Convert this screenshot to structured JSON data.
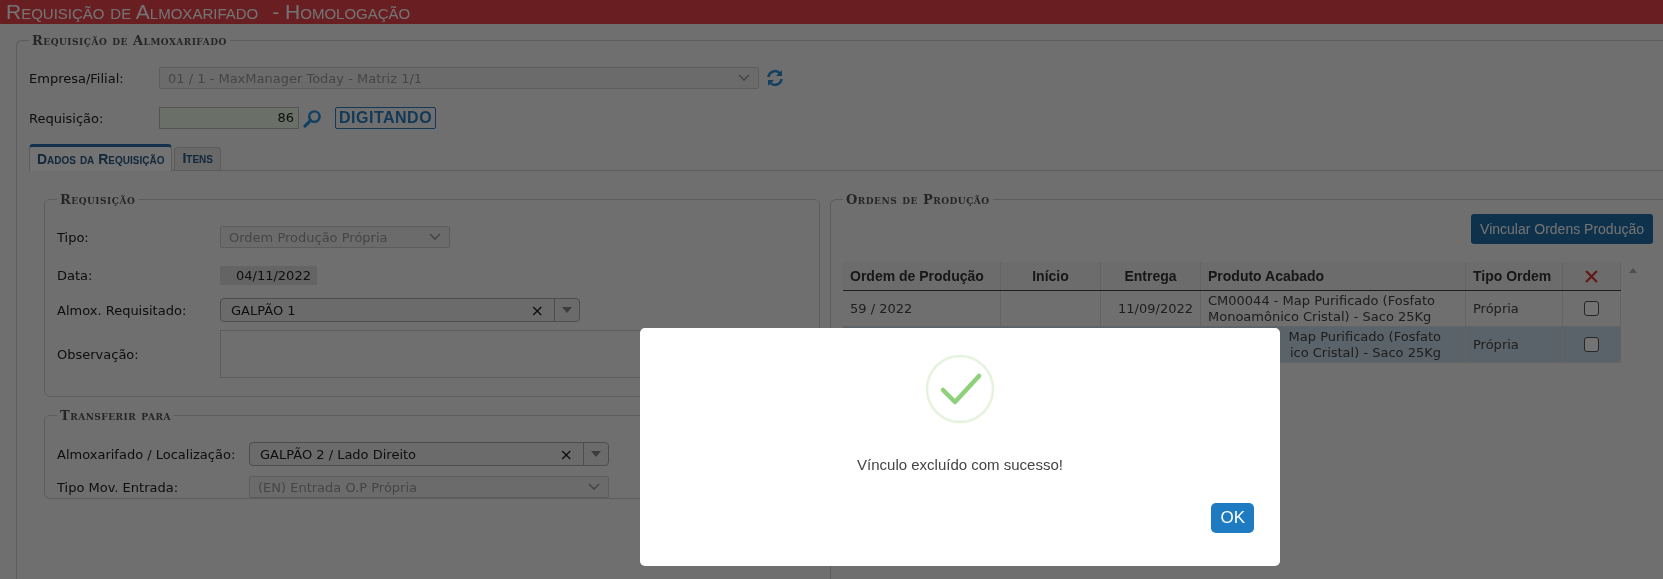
{
  "header": {
    "title": "Requisição de Almoxarifado",
    "subtitle": "- Homologação"
  },
  "main_section": {
    "legend": "Requisição de Almoxarifado",
    "empresa": {
      "label": "Empresa/Filial:",
      "value": "01 / 1 - MaxManager Today - Matriz 1/1"
    },
    "requisicao": {
      "label": "Requisição:",
      "value": "86",
      "status": "DIGITANDO"
    }
  },
  "tabs": [
    {
      "label": "Dados da Requisição",
      "selected": true
    },
    {
      "label": "Itens",
      "selected": false
    }
  ],
  "requisicao_section": {
    "legend": "Requisição",
    "fields": [
      {
        "kind": "select",
        "label": "Tipo:",
        "value": "Ordem Produção Própria"
      },
      {
        "kind": "date",
        "label": "Data:",
        "value": "04/11/2022"
      },
      {
        "kind": "combo",
        "label": "Almox. Requisitado:",
        "value": "GALPÃO 1",
        "clear": "×"
      },
      {
        "kind": "textarea",
        "label": "Observação:"
      }
    ]
  },
  "transfer_section": {
    "legend": "Transferir para",
    "fields": [
      {
        "kind": "combo",
        "label": "Almoxarifado / Localização:",
        "value": "GALPÃO 2 / Lado Direito",
        "clear": "×"
      },
      {
        "kind": "select",
        "label": "Tipo Mov. Entrada:",
        "value": "(EN) Entrada O.P Própria"
      }
    ]
  },
  "orders_section": {
    "legend": "Ordens de Produção",
    "button": "Vincular Ordens Produção",
    "table": {
      "columns": [
        "Ordem de Produção",
        "Início",
        "Entrega",
        "Produto Acabado",
        "Tipo Ordem"
      ],
      "rows": [
        {
          "ordem": "59 / 2022",
          "entrega": "11/09/2022",
          "produto": [
            "CM00044 - Map Purificado (Fosfato",
            "Monoamônico Cristal) - Saco 25Kg"
          ],
          "tipo": "Própria",
          "checked": false,
          "selected": false
        },
        {
          "produto": [
            "Map Purificado (Fosfato",
            "ico Cristal) - Saco 25Kg"
          ],
          "tipo": "Própria",
          "checked": false,
          "selected": true
        }
      ]
    }
  },
  "dialog": {
    "message": "Vínculo excluído com sucesso!",
    "button": "OK"
  }
}
